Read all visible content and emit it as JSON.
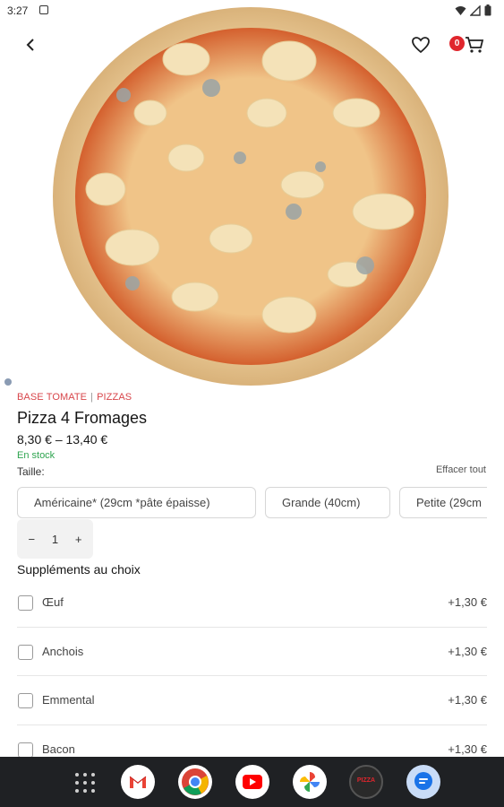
{
  "status_bar": {
    "time": "3:27"
  },
  "header": {
    "cart_count": "0",
    "accent_color": "#e0262d"
  },
  "product": {
    "breadcrumb": [
      "BASE TOMATE",
      "PIZZAS"
    ],
    "breadcrumb_separator": "|",
    "title": "Pizza 4 Fromages",
    "price_range": "8,30 € – 13,40 €",
    "stock": "En stock",
    "size_label": "Taille:",
    "clear_label": "Effacer tout",
    "sizes": [
      "Américaine* (29cm *pâte épaisse)",
      "Grande (40cm)",
      "Petite (29cm"
    ]
  },
  "quantity": {
    "minus": "−",
    "value": "1",
    "plus": "+"
  },
  "supplements": {
    "title": "Suppléments au choix",
    "items": [
      {
        "name": "Œuf",
        "price": "+1,30 €"
      },
      {
        "name": "Anchois",
        "price": "+1,30 €"
      },
      {
        "name": "Emmental",
        "price": "+1,30 €"
      },
      {
        "name": "Bacon",
        "price": "+1,30 €"
      }
    ]
  },
  "dock": {
    "apps": [
      "gmail-icon",
      "chrome-icon",
      "youtube-icon",
      "photos-icon",
      "pizza-app-icon",
      "messages-icon"
    ],
    "pizza_app_label": "PIZZA"
  }
}
